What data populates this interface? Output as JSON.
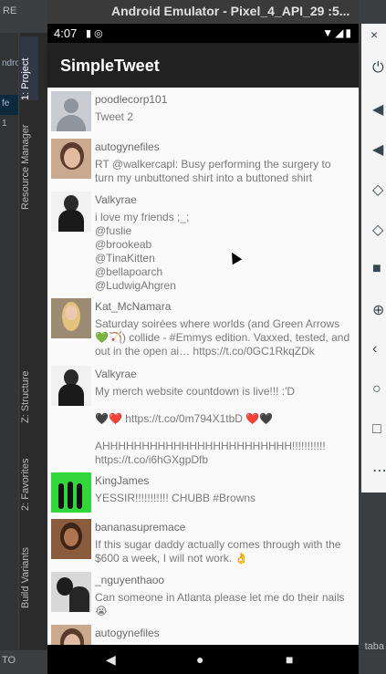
{
  "ide": {
    "tab_label": "RE",
    "left_rows": [
      "ndroi",
      "",
      "fe",
      "1",
      "",
      "",
      "",
      "",
      "",
      "",
      "",
      "",
      "",
      "",
      "",
      ""
    ],
    "vertical_tabs": [
      "1: Project",
      "Resource Manager",
      "Z: Structure",
      "2: Favorites",
      "Build Variants"
    ],
    "bottom_label": "TO",
    "bottom_right": "taba"
  },
  "emulator": {
    "title": "Android Emulator - Pixel_4_API_29 :5...",
    "status": {
      "time": "4:07"
    }
  },
  "app": {
    "title": "SimpleTweet"
  },
  "tweets": [
    {
      "name": "poodlecorp101",
      "body": "Tweet 2"
    },
    {
      "name": "autogynefiles",
      "body": "RT @walkercapl: Busy performing the surgery to turn my unbuttoned shirt into a buttoned shirt"
    },
    {
      "name": "Valkyrae",
      "body": "i love my friends ;_;\n@fuslie\n@brookeab\n@TinaKitten\n@bellapoarch\n@LudwigAhgren"
    },
    {
      "name": "Kat_McNamara",
      "body": "Saturday soirées where worlds (and Green Arrows 💚🏹) collide - #Emmys edition. Vaxxed, tested, and out in the open ai… https://t.co/0GC1RkqZDk"
    },
    {
      "name": "Valkyrae",
      "body": "My merch website countdown is live!!! :'D\n\n🖤❤️ https://t.co/0m794X1tbD ❤️🖤\n\nAHHHHHHHHHHHHHHHHHHHHHHHH!!!!!!!!!!!\nhttps://t.co/i6hGXgpDfb"
    },
    {
      "name": "KingJames",
      "body": "YESSIR!!!!!!!!!!! CHUBB #Browns"
    },
    {
      "name": "bananasupremace",
      "body": "If this sugar daddy actually comes through with the $600 a week, I will not work. 👌"
    },
    {
      "name": "_nguyenthaoo",
      "body": "Can someone in Atlanta please let me do their nails 😭"
    },
    {
      "name": "autogynefiles",
      "body": ""
    }
  ],
  "icons": {
    "close": "×",
    "nav_back": "◀",
    "nav_home": "●",
    "nav_recent": "■"
  }
}
